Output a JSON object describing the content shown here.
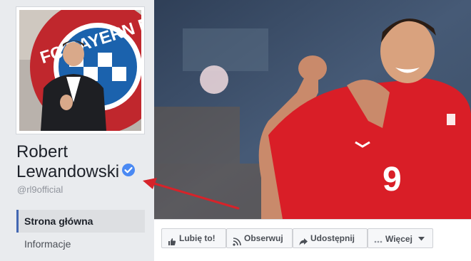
{
  "profile": {
    "name_line1": "Robert",
    "name_line2": "Lewandowski",
    "handle": "@rl9official",
    "verified": true,
    "avatar_text": "FC BAYERN M"
  },
  "nav": {
    "items": [
      {
        "label": "Strona główna",
        "active": true
      },
      {
        "label": "Informacje",
        "active": false
      }
    ]
  },
  "cover": {
    "jersey_number": "9"
  },
  "actions": {
    "like_label": "Lubię to!",
    "follow_label": "Obserwuj",
    "share_label": "Udostępnij",
    "more_label": "Więcej"
  },
  "colors": {
    "verified_badge": "#4a89f3",
    "annotation_arrow": "#d6232a",
    "active_nav_border": "#4267b2"
  }
}
